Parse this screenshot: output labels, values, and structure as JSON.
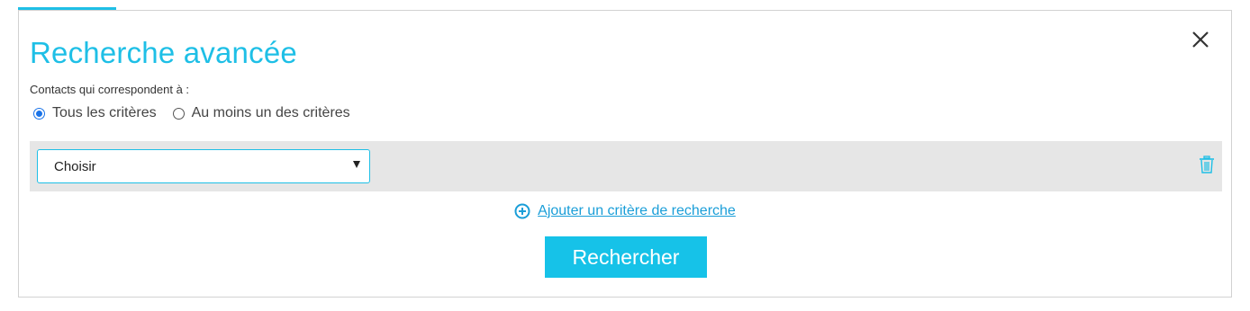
{
  "title": "Recherche avancée",
  "subtitle": "Contacts qui correspondent à :",
  "match_options": [
    {
      "label": "Tous les critères",
      "checked": true
    },
    {
      "label": "Au moins un des critères",
      "checked": false
    }
  ],
  "criteria": {
    "select_value": "Choisir"
  },
  "add_criterion_label": "Ajouter un critère de recherche",
  "search_button_label": "Rechercher",
  "icons": {
    "close": "close-icon",
    "delete": "trash-icon",
    "add": "plus-circle-icon"
  },
  "colors": {
    "accent": "#1ebfe6",
    "link": "#1a9ed8",
    "button": "#16c2e8"
  }
}
